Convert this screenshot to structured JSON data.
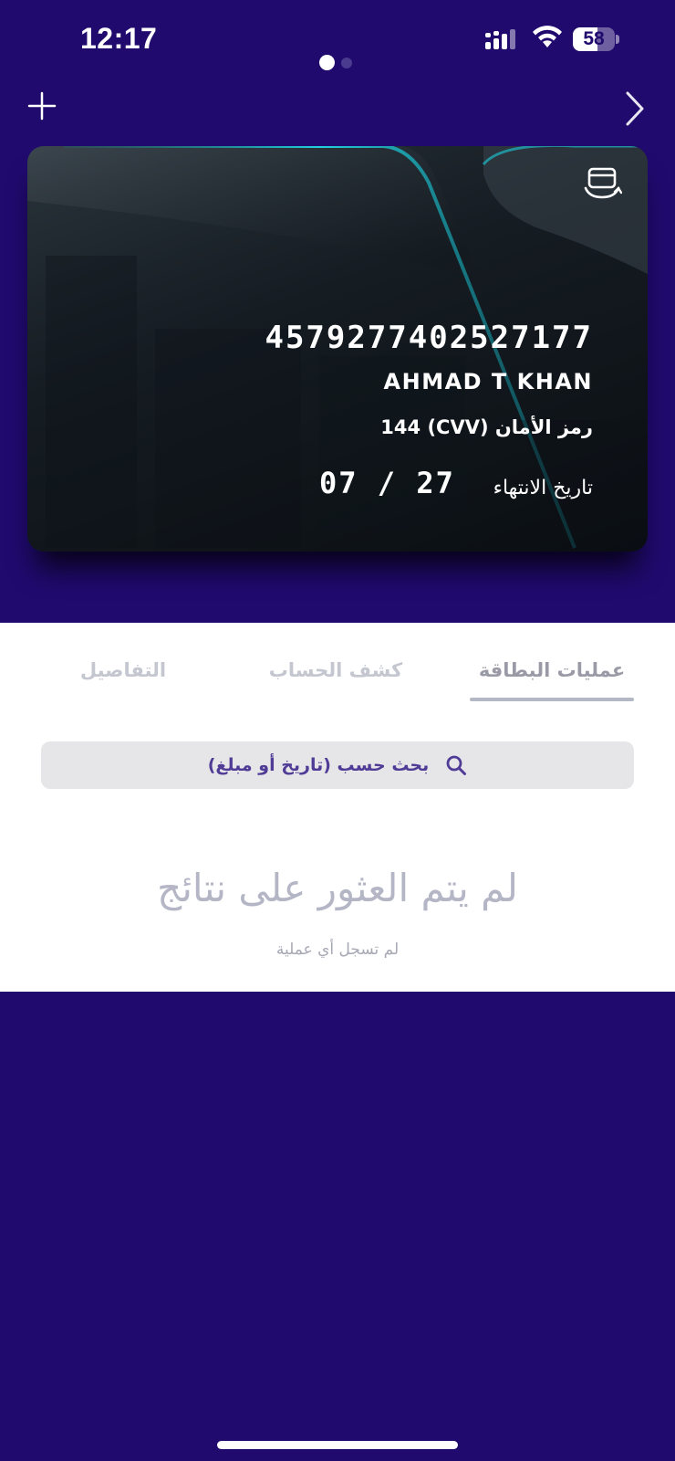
{
  "status_bar": {
    "time": "12:17",
    "battery_level": "58",
    "signal_icon": "cellular-signal-icon",
    "wifi_icon": "wifi-icon"
  },
  "pager": {
    "pages": 2,
    "active": 1
  },
  "nav": {
    "add_icon": "plus-icon",
    "next_icon": "chevron-right-icon"
  },
  "card": {
    "number": "4579277402527177",
    "holder": "AHMAD T KHAN",
    "cvv_label": "رمز الأمان (CVV)",
    "cvv_value": "144",
    "expiry_label": "تاريخ الانتهاء",
    "expiry_value": "07 / 27",
    "switch_icon": "card-flip-icon",
    "accent_color": "#1ab0c0"
  },
  "tabs": [
    {
      "label": "عمليات البطاقة",
      "active": true
    },
    {
      "label": "كشف الحساب",
      "active": false
    },
    {
      "label": "التفاصيل",
      "active": false
    }
  ],
  "search": {
    "placeholder": "بحث حسب (تاريخ أو مبلغ)",
    "icon": "search-icon"
  },
  "empty_state": {
    "title": "لم يتم العثور على نتائج",
    "subtitle": "لم تسجل أي عملية"
  },
  "colors": {
    "background": "#200a6e",
    "panel": "#ffffff",
    "search_text": "#503c96"
  }
}
